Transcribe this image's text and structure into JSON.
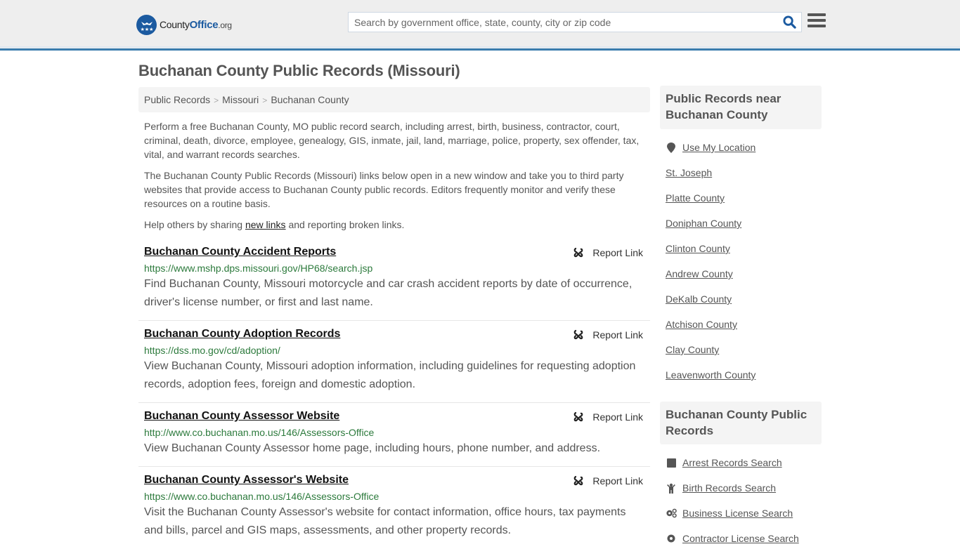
{
  "header": {
    "logo": {
      "county": "County",
      "office": "Office",
      "org": ".org"
    },
    "search_placeholder": "Search by government office, state, county, city or zip code",
    "search_icon": "search-icon",
    "menu_icon": "hamburger-menu-icon"
  },
  "page": {
    "title": "Buchanan County Public Records (Missouri)",
    "breadcrumb": [
      "Public Records",
      "Missouri",
      "Buchanan County"
    ],
    "breadcrumb_separator": ">",
    "intro": [
      "Perform a free Buchanan County, MO public record search, including arrest, birth, business, contractor, court, criminal, death, divorce, employee, genealogy, GIS, inmate, jail, land, marriage, police, property, sex offender, tax, vital, and warrant records searches.",
      "The Buchanan County Public Records (Missouri) links below open in a new window and take you to third party websites that provide access to Buchanan County public records. Editors frequently monitor and verify these resources on a routine basis."
    ],
    "help": {
      "before": "Help others by sharing ",
      "link": "new links",
      "after": " and reporting broken links."
    }
  },
  "listings": [
    {
      "title": "Buchanan County Accident Reports",
      "url": "https://www.mshp.dps.missouri.gov/HP68/search.jsp",
      "description": "Find Buchanan County, Missouri motorcycle and car crash accident reports by date of occurrence, driver's license number, or first and last name.",
      "report_label": "Report Link"
    },
    {
      "title": "Buchanan County Adoption Records",
      "url": "https://dss.mo.gov/cd/adoption/",
      "description": "View Buchanan County, Missouri adoption information, including guidelines for requesting adoption records, adoption fees, foreign and domestic adoption.",
      "report_label": "Report Link"
    },
    {
      "title": "Buchanan County Assessor Website",
      "url": "http://www.co.buchanan.mo.us/146/Assessors-Office",
      "description": "View Buchanan County Assessor home page, including hours, phone number, and address.",
      "report_label": "Report Link"
    },
    {
      "title": "Buchanan County Assessor's Website",
      "url": "https://www.co.buchanan.mo.us/146/Assessors-Office",
      "description": "Visit the Buchanan County Assessor's website for contact information, office hours, tax payments and bills, parcel and GIS maps, assessments, and other property records.",
      "report_label": "Report Link"
    }
  ],
  "sidebar": {
    "nearby_title": "Public Records near Buchanan County",
    "use_location": "Use My Location",
    "nearby": [
      "St. Joseph",
      "Platte County",
      "Doniphan County",
      "Clinton County",
      "Andrew County",
      "DeKalb County",
      "Atchison County",
      "Clay County",
      "Leavenworth County"
    ],
    "records_title": "Buchanan County Public Records",
    "records": [
      {
        "label": "Arrest Records Search",
        "icon": "square-icon"
      },
      {
        "label": "Birth Records Search",
        "icon": "child-icon"
      },
      {
        "label": "Business License Search",
        "icon": "gears-icon"
      },
      {
        "label": "Contractor License Search",
        "icon": "gear-icon"
      }
    ]
  },
  "colors": {
    "brand_blue": "#1b5aa0",
    "header_border": "#3a7cad",
    "url_green": "#2c7a3c",
    "text_gray": "#555555"
  }
}
